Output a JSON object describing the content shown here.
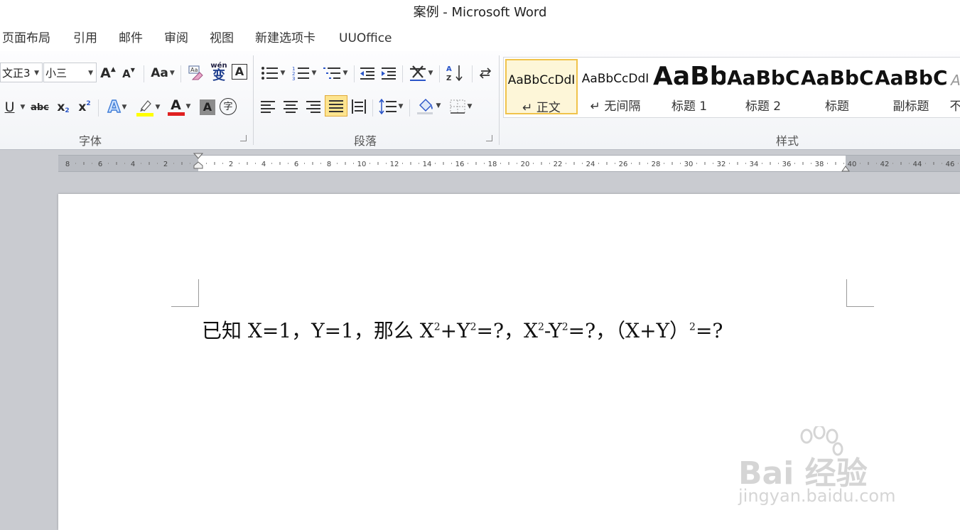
{
  "window": {
    "title": "案例 - Microsoft Word"
  },
  "tabs": [
    "页面布局",
    "引用",
    "邮件",
    "审阅",
    "视图",
    "新建选项卡",
    "UUOffice"
  ],
  "font_group": {
    "label": "字体",
    "font_name": "文正3",
    "font_size": "小三",
    "grow_label": "A",
    "shrink_label": "A",
    "case_label": "Aa",
    "phonetic_label": "wén",
    "phonetic_char": "变",
    "border_char": "A",
    "underline_label": "U",
    "strike_label": "abc",
    "sub_label": "x",
    "sub_mark": "2",
    "sup_label": "x",
    "sup_mark": "2",
    "effects_label": "A",
    "highlight_color": "#ffff00",
    "font_color_label": "A",
    "font_color": "#e02020",
    "shading_char": "A",
    "enclose_char": "字"
  },
  "paragraph_group": {
    "label": "段落"
  },
  "styles_group": {
    "label": "样式",
    "items": [
      {
        "sample": "AaBbCcDdI",
        "name": "↵ 正文"
      },
      {
        "sample": "AaBbCcDdI",
        "name": "↵ 无间隔"
      },
      {
        "sample": "AaBb",
        "name": "标题 1"
      },
      {
        "sample": "AaBbC",
        "name": "标题 2"
      },
      {
        "sample": "AaBbC",
        "name": "标题"
      },
      {
        "sample": "AaBbC",
        "name": "副标题"
      },
      {
        "sample": "A",
        "name": "不"
      }
    ]
  },
  "ruler": {
    "labels": [
      "8",
      "6",
      "4",
      "2",
      "2",
      "4",
      "6",
      "8",
      "10",
      "12",
      "14",
      "16",
      "18",
      "20",
      "22",
      "24",
      "26",
      "28",
      "30",
      "32",
      "34",
      "36",
      "38",
      "40",
      "42",
      "44",
      "46"
    ]
  },
  "document": {
    "line": {
      "p1": "已知 X=1，Y=1，那么 X",
      "sup1": "2",
      "p2": "+Y",
      "sup2": "2",
      "p3": "=?，X",
      "sup3": "2",
      "p4": "-Y",
      "sup4": "2",
      "p5": "=?，（X+Y）",
      "sup5": "2",
      "p6": "=?"
    }
  },
  "watermark": {
    "main": "Bai 经验",
    "sub": "jingyan.baidu.com"
  }
}
